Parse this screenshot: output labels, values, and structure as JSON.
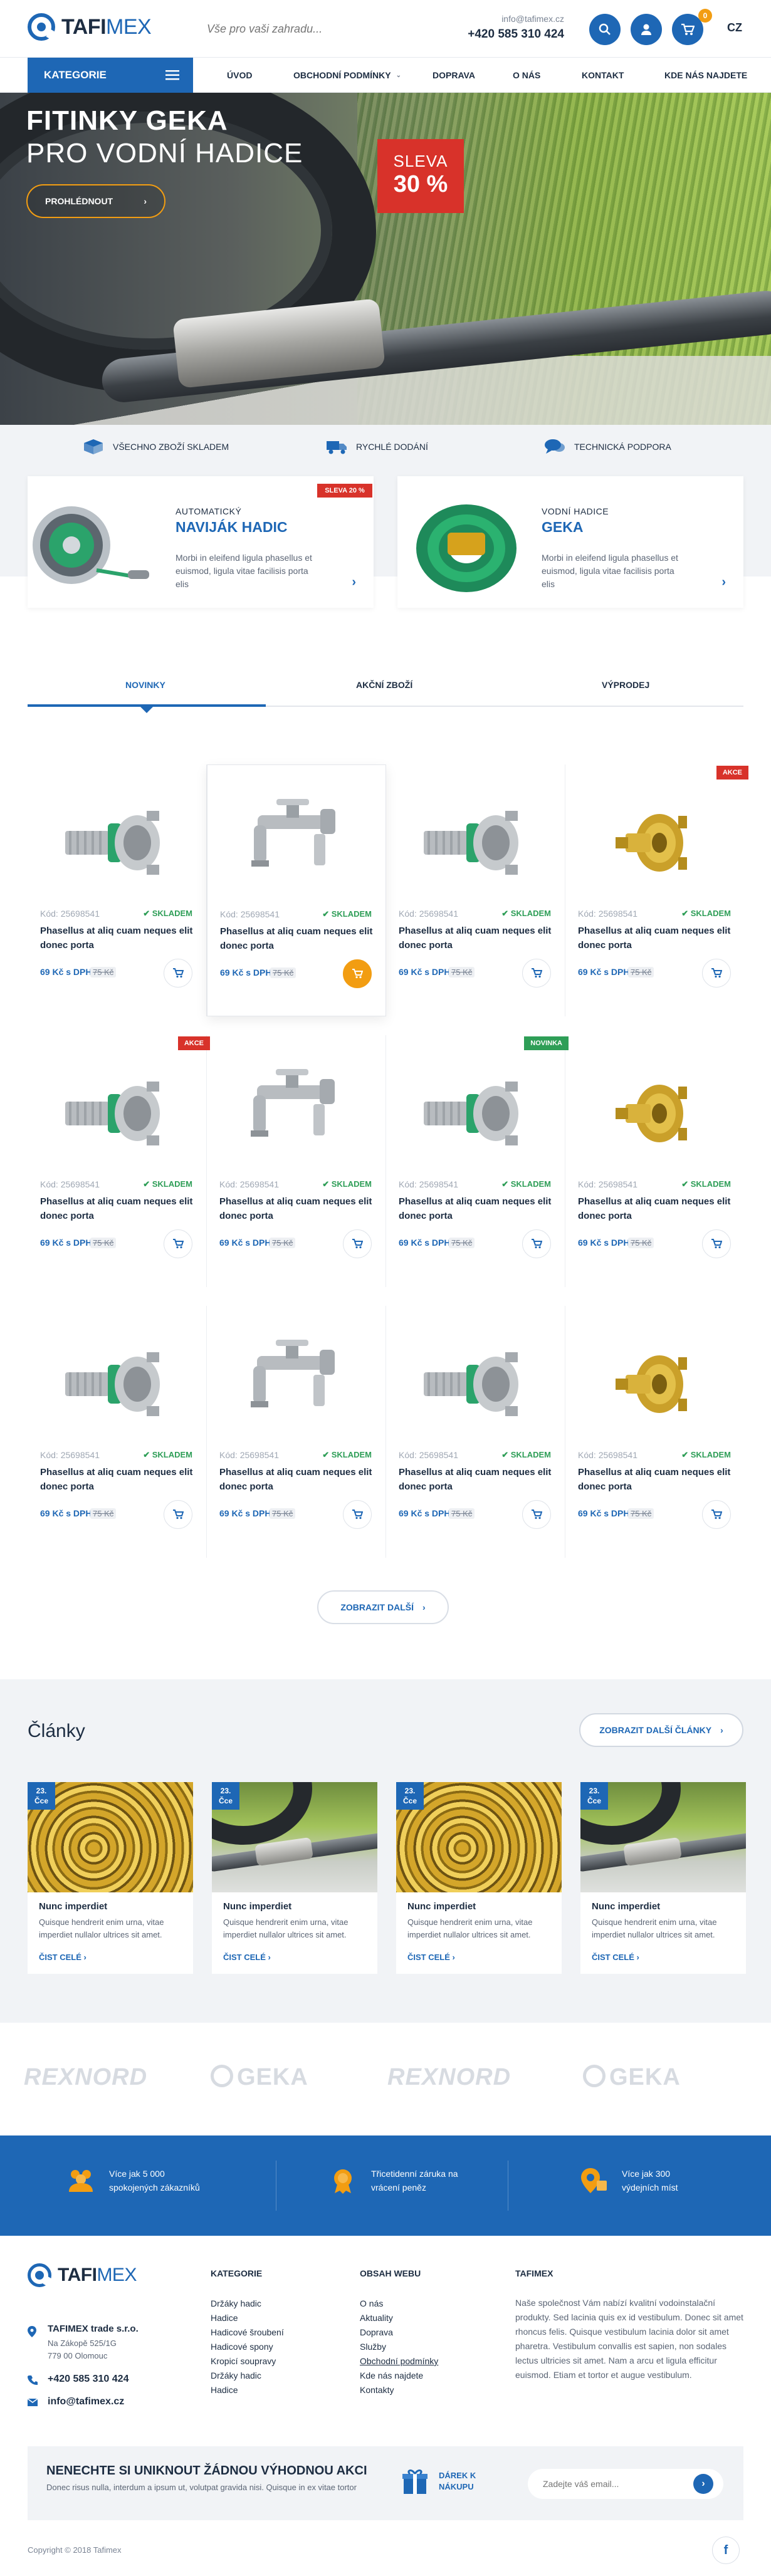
{
  "header": {
    "logo_a": "TAFI",
    "logo_b": "MEX",
    "search_placeholder": "Vše pro vaši zahradu...",
    "email": "info@tafimex.cz",
    "phone": "+420 585 310 424",
    "cart_count": "0",
    "lang": "CZ"
  },
  "nav": {
    "categories": "KATEGORIE",
    "items": [
      "ÚVOD",
      "OBCHODNÍ PODMÍNKY",
      "DOPRAVA",
      "O NÁS",
      "KONTAKT",
      "KDE NÁS NAJDETE"
    ]
  },
  "hero": {
    "title1": "FITINKY GEKA",
    "title2": "PRO VODNÍ HADICE",
    "button": "PROHLÉDNOUT",
    "sale_label": "SLEVA",
    "sale_value": "30 %"
  },
  "features": [
    "VŠECHNO ZBOŽÍ SKLADEM",
    "RYCHLÉ DODÁNÍ",
    "TECHNICKÁ PODPORA"
  ],
  "promo": [
    {
      "small": "AUTOMATICKÝ",
      "big": "NAVIJÁK HADIC",
      "desc": "Morbi in eleifend ligula phasellus et euismod, ligula vitae facilisis porta elis",
      "badge": "SLEVA 20 %"
    },
    {
      "small": "VODNÍ HADICE",
      "big": "GEKA",
      "desc": "Morbi in eleifend ligula phasellus et euismod, ligula vitae facilisis porta elis",
      "badge": ""
    }
  ],
  "tabs": [
    "NOVINKY",
    "AKČNÍ ZBOŽÍ",
    "VÝPRODEJ"
  ],
  "products": {
    "code": "Kód: 25698541",
    "stock": "SKLADEM",
    "name": "Phasellus at aliq cuam neques elit donec porta",
    "price": "69 Kč s DPH",
    "old_price": "75 Kč",
    "badges": {
      "akce": "AKCE",
      "novinka": "NOVINKA"
    },
    "badge_colors": {
      "akce": "#d8322a",
      "novinka": "#2e9e57"
    }
  },
  "show_more": "ZOBRAZIT DALŠÍ",
  "articles": {
    "heading": "Články",
    "more": "ZOBRAZIT DALŠÍ ČLÁNKY",
    "date_day": "23.",
    "date_month": "Čce",
    "title": "Nunc imperdiet",
    "desc": "Quisque hendrerit enim urna, vitae imperdiet nullalor ultrices sit amet.",
    "link": "ČIST CELÉ"
  },
  "brands": [
    "REXNORD",
    "GEKA",
    "REXNORD",
    "GEKA"
  ],
  "benefits": [
    "Více jak 5 000 spokojených zákazníků",
    "Třicetidenní záruka na vrácení peněz",
    "Více jak 300 výdejních míst"
  ],
  "footer": {
    "company": "TAFIMEX trade s.r.o.",
    "addr1": "Na Zákopě 525/1G",
    "addr2": "779 00 Olomouc",
    "phone": "+420 585 310 424",
    "email": "info@tafimex.cz",
    "col1_h": "KATEGORIE",
    "col1": [
      "Držáky hadic",
      "Hadice",
      "Hadicové šroubení",
      "Hadicové spony",
      "Kropicí soupravy",
      "Držáky hadic",
      "Hadice"
    ],
    "col2_h": "OBSAH WEBU",
    "col2": [
      "O nás",
      "Aktuality",
      "Doprava",
      "Služby",
      "Obchodní podmínky",
      "Kde nás najdete",
      "Kontakty"
    ],
    "col3_h": "TAFIMEX",
    "about": "Naše společnost Vám nabízí kvalitní vodoinstalační produkty. Sed lacinia quis ex id vestibulum. Donec sit amet rhoncus felis. Quisque vestibulum lacinia dolor sit amet pharetra. Vestibulum convallis est sapien, non sodales lectus ultricies sit amet. Nam a arcu et ligula efficitur euismod. Etiam et tortor et augue vestibulum.",
    "news_title": "NENECHTE SI UNIKNOUT ŽÁDNOU VÝHODNOU AKCI",
    "news_desc": "Donec risus nulla, interdum a ipsum ut, volutpat gravida nisi. Quisque in ex vitae tortor",
    "gift": "DÁREK K NÁKUPU",
    "email_placeholder": "Zadejte váš email...",
    "copyright": "Copyright © 2018 Tafimex"
  },
  "colors": {
    "primary": "#1e67b5",
    "accent": "#f29d12",
    "sale": "#d8322a",
    "stock": "#2e9e57"
  }
}
